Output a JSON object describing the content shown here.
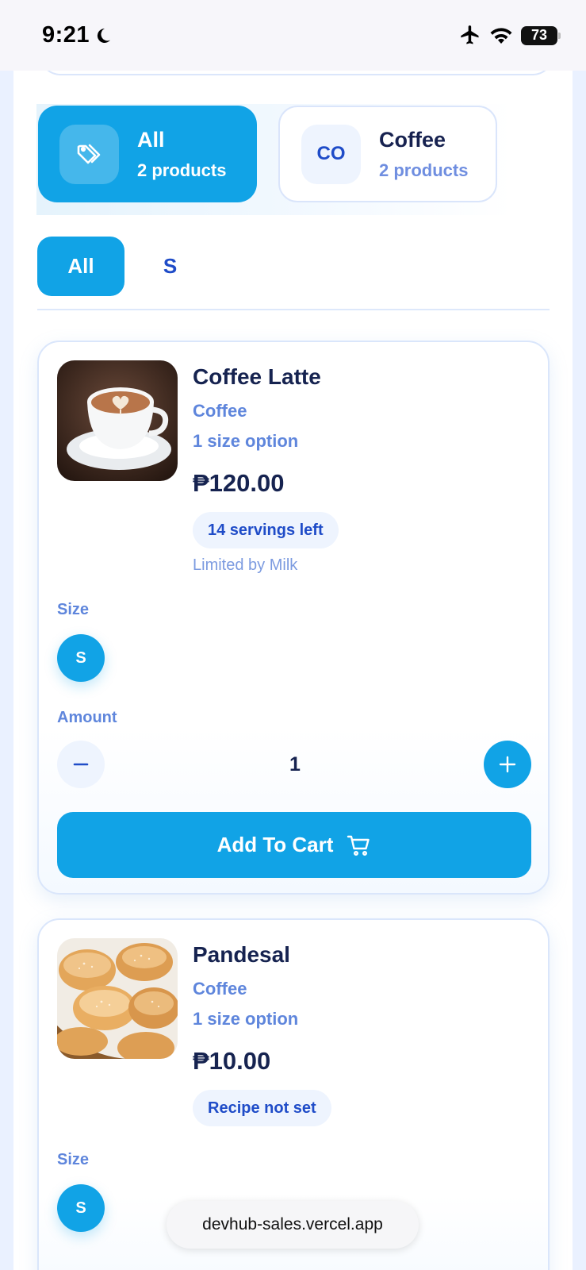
{
  "status_bar": {
    "time": "9:21",
    "battery": "73"
  },
  "categories": [
    {
      "name": "All",
      "count": "2 products",
      "icon": "tag-icon",
      "active": true
    },
    {
      "name": "Coffee",
      "count": "2 products",
      "abbr": "CO",
      "active": false
    }
  ],
  "size_filters": [
    {
      "label": "All",
      "active": true
    },
    {
      "label": "S",
      "active": false
    }
  ],
  "products": [
    {
      "name": "Coffee Latte",
      "category": "Coffee",
      "size_options": "1 size option",
      "price": "₱120.00",
      "badge": "14 servings left",
      "limit_note": "Limited by Milk",
      "size_label": "Size",
      "selected_size": "S",
      "amount_label": "Amount",
      "quantity": "1",
      "add_to_cart_label": "Add To Cart"
    },
    {
      "name": "Pandesal",
      "category": "Coffee",
      "size_options": "1 size option",
      "price": "₱10.00",
      "badge": "Recipe not set",
      "size_label": "Size",
      "selected_size": "S"
    }
  ],
  "browser": {
    "url": "devhub-sales.vercel.app"
  },
  "colors": {
    "accent": "#11a3e6",
    "navy": "#162350",
    "muted_blue": "#5f86dc",
    "badge_bg": "#eef4fe"
  }
}
